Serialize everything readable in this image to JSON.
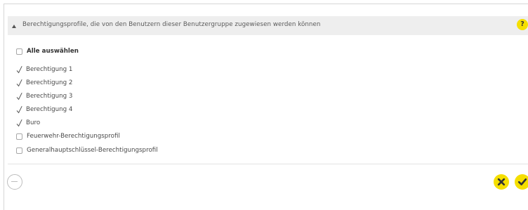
{
  "section": {
    "title": "Berechtigungsprofile, die von den Benutzern dieser Benutzergruppe zugewiesen werden können",
    "help_label": "?",
    "icons": {
      "toggle": "chevron-up-icon",
      "help": "question-mark-icon"
    }
  },
  "select_all": {
    "label": "Alle auswählen",
    "checked": false
  },
  "profiles": [
    {
      "label": "Berechtigung 1",
      "checked": true
    },
    {
      "label": "Berechtigung 2",
      "checked": true
    },
    {
      "label": "Berechtigung 3",
      "checked": true
    },
    {
      "label": "Berechtigung 4",
      "checked": true
    },
    {
      "label": "Buro",
      "checked": true
    },
    {
      "label": "Feuerwehr-Berechtigungsprofil",
      "checked": false
    },
    {
      "label": "Generalhauptschlüssel-Berechtigungsprofil",
      "checked": false
    }
  ],
  "footer": {
    "icons": {
      "remove": "minus-circle-icon",
      "cancel": "x-icon",
      "confirm": "checkmark-icon"
    }
  },
  "colors": {
    "accent": "#f5df00",
    "header_background": "#eeeeee",
    "divider": "#e4e4e4",
    "muted_icon": "#bdbdbd"
  }
}
